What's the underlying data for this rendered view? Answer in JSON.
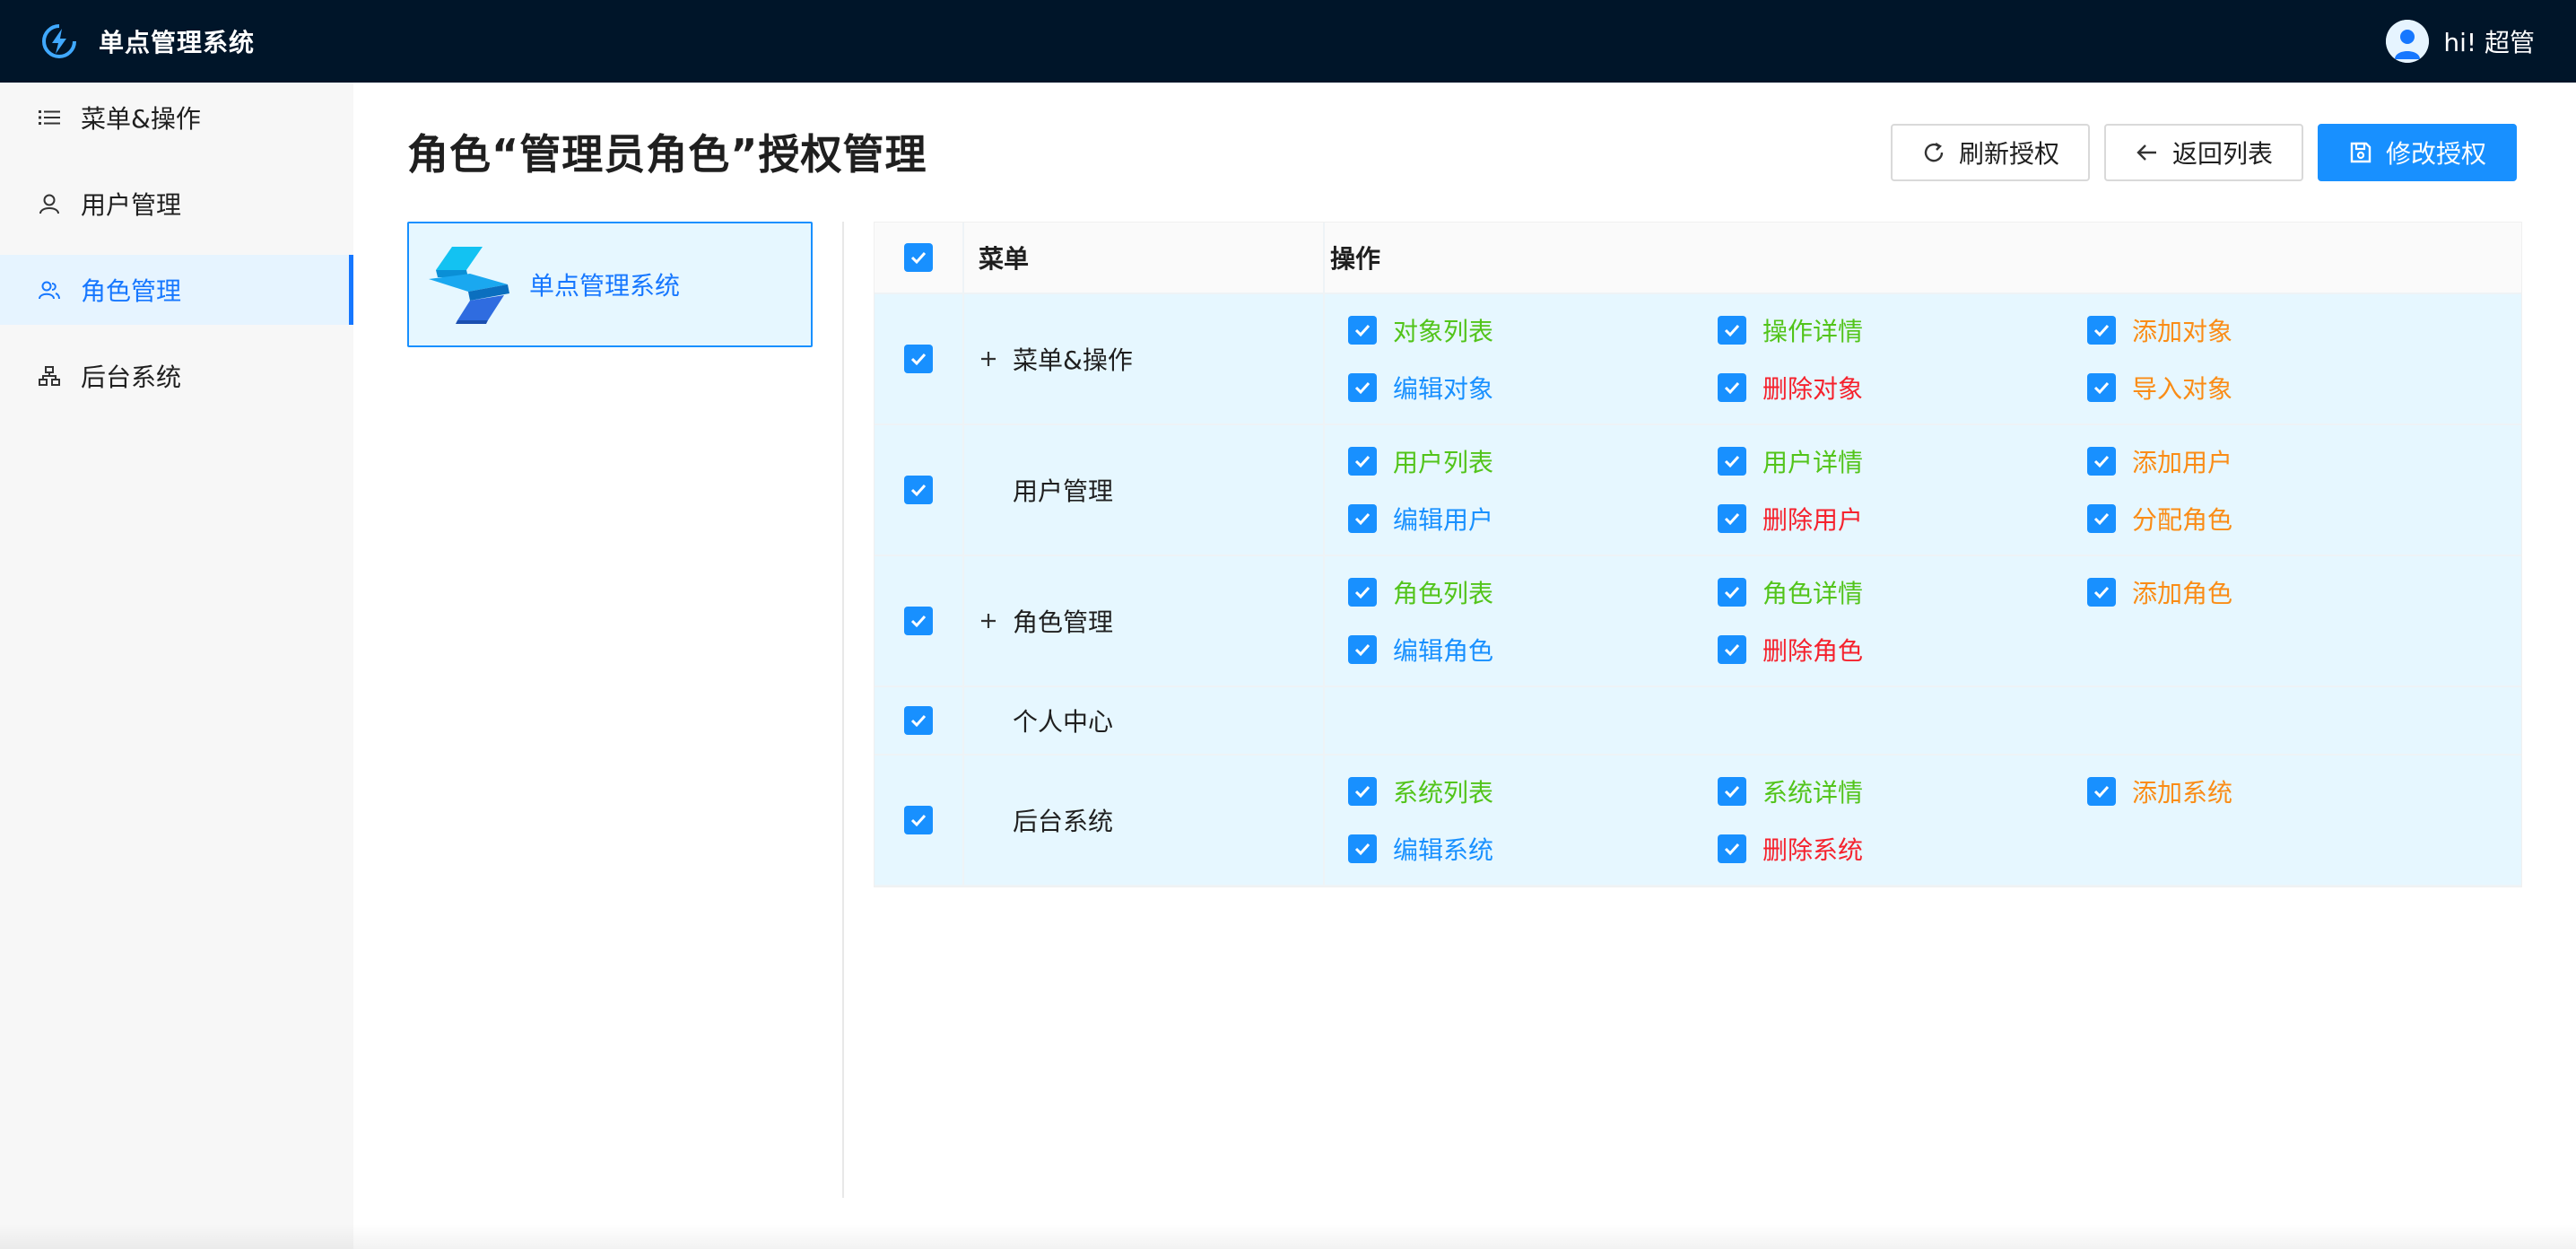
{
  "header": {
    "title": "单点管理系统",
    "user_greeting": "hi! 超管"
  },
  "sidebar": {
    "items": [
      {
        "label": "菜单&操作",
        "icon": "list-icon",
        "active": false
      },
      {
        "label": "用户管理",
        "icon": "user-icon",
        "active": false
      },
      {
        "label": "角色管理",
        "icon": "team-icon",
        "active": true
      },
      {
        "label": "后台系统",
        "icon": "cluster-icon",
        "active": false
      }
    ]
  },
  "main": {
    "title": "角色“管理员角色”授权管理",
    "buttons": {
      "refresh": "刷新授权",
      "back": "返回列表",
      "save": "修改授权"
    },
    "app": {
      "name": "单点管理系统"
    },
    "table": {
      "headers": {
        "menu": "菜单",
        "ops": "操作"
      },
      "rows": [
        {
          "menu": "菜单&操作",
          "expandable": true,
          "ops": [
            {
              "label": "对象列表",
              "color": "#52c41a"
            },
            {
              "label": "操作详情",
              "color": "#52c41a"
            },
            {
              "label": "添加对象",
              "color": "#fa8c16"
            },
            {
              "label": "编辑对象",
              "color": "#1890ff"
            },
            {
              "label": "删除对象",
              "color": "#f5222d"
            },
            {
              "label": "导入对象",
              "color": "#fa8c16"
            }
          ]
        },
        {
          "menu": "用户管理",
          "expandable": false,
          "ops": [
            {
              "label": "用户列表",
              "color": "#52c41a"
            },
            {
              "label": "用户详情",
              "color": "#52c41a"
            },
            {
              "label": "添加用户",
              "color": "#fa8c16"
            },
            {
              "label": "编辑用户",
              "color": "#1890ff"
            },
            {
              "label": "删除用户",
              "color": "#f5222d"
            },
            {
              "label": "分配角色",
              "color": "#fa8c16"
            }
          ]
        },
        {
          "menu": "角色管理",
          "expandable": true,
          "ops": [
            {
              "label": "角色列表",
              "color": "#52c41a"
            },
            {
              "label": "角色详情",
              "color": "#52c41a"
            },
            {
              "label": "添加角色",
              "color": "#fa8c16"
            },
            {
              "label": "编辑角色",
              "color": "#1890ff"
            },
            {
              "label": "删除角色",
              "color": "#f5222d"
            }
          ]
        },
        {
          "menu": "个人中心",
          "expandable": false,
          "ops": []
        },
        {
          "menu": "后台系统",
          "expandable": false,
          "ops": [
            {
              "label": "系统列表",
              "color": "#52c41a"
            },
            {
              "label": "系统详情",
              "color": "#52c41a"
            },
            {
              "label": "添加系统",
              "color": "#fa8c16"
            },
            {
              "label": "编辑系统",
              "color": "#1890ff"
            },
            {
              "label": "删除系统",
              "color": "#f5222d"
            }
          ]
        }
      ]
    }
  },
  "colors": {
    "header_bg": "#001529",
    "primary": "#1890ff",
    "row_bg": "#e6f7ff"
  }
}
